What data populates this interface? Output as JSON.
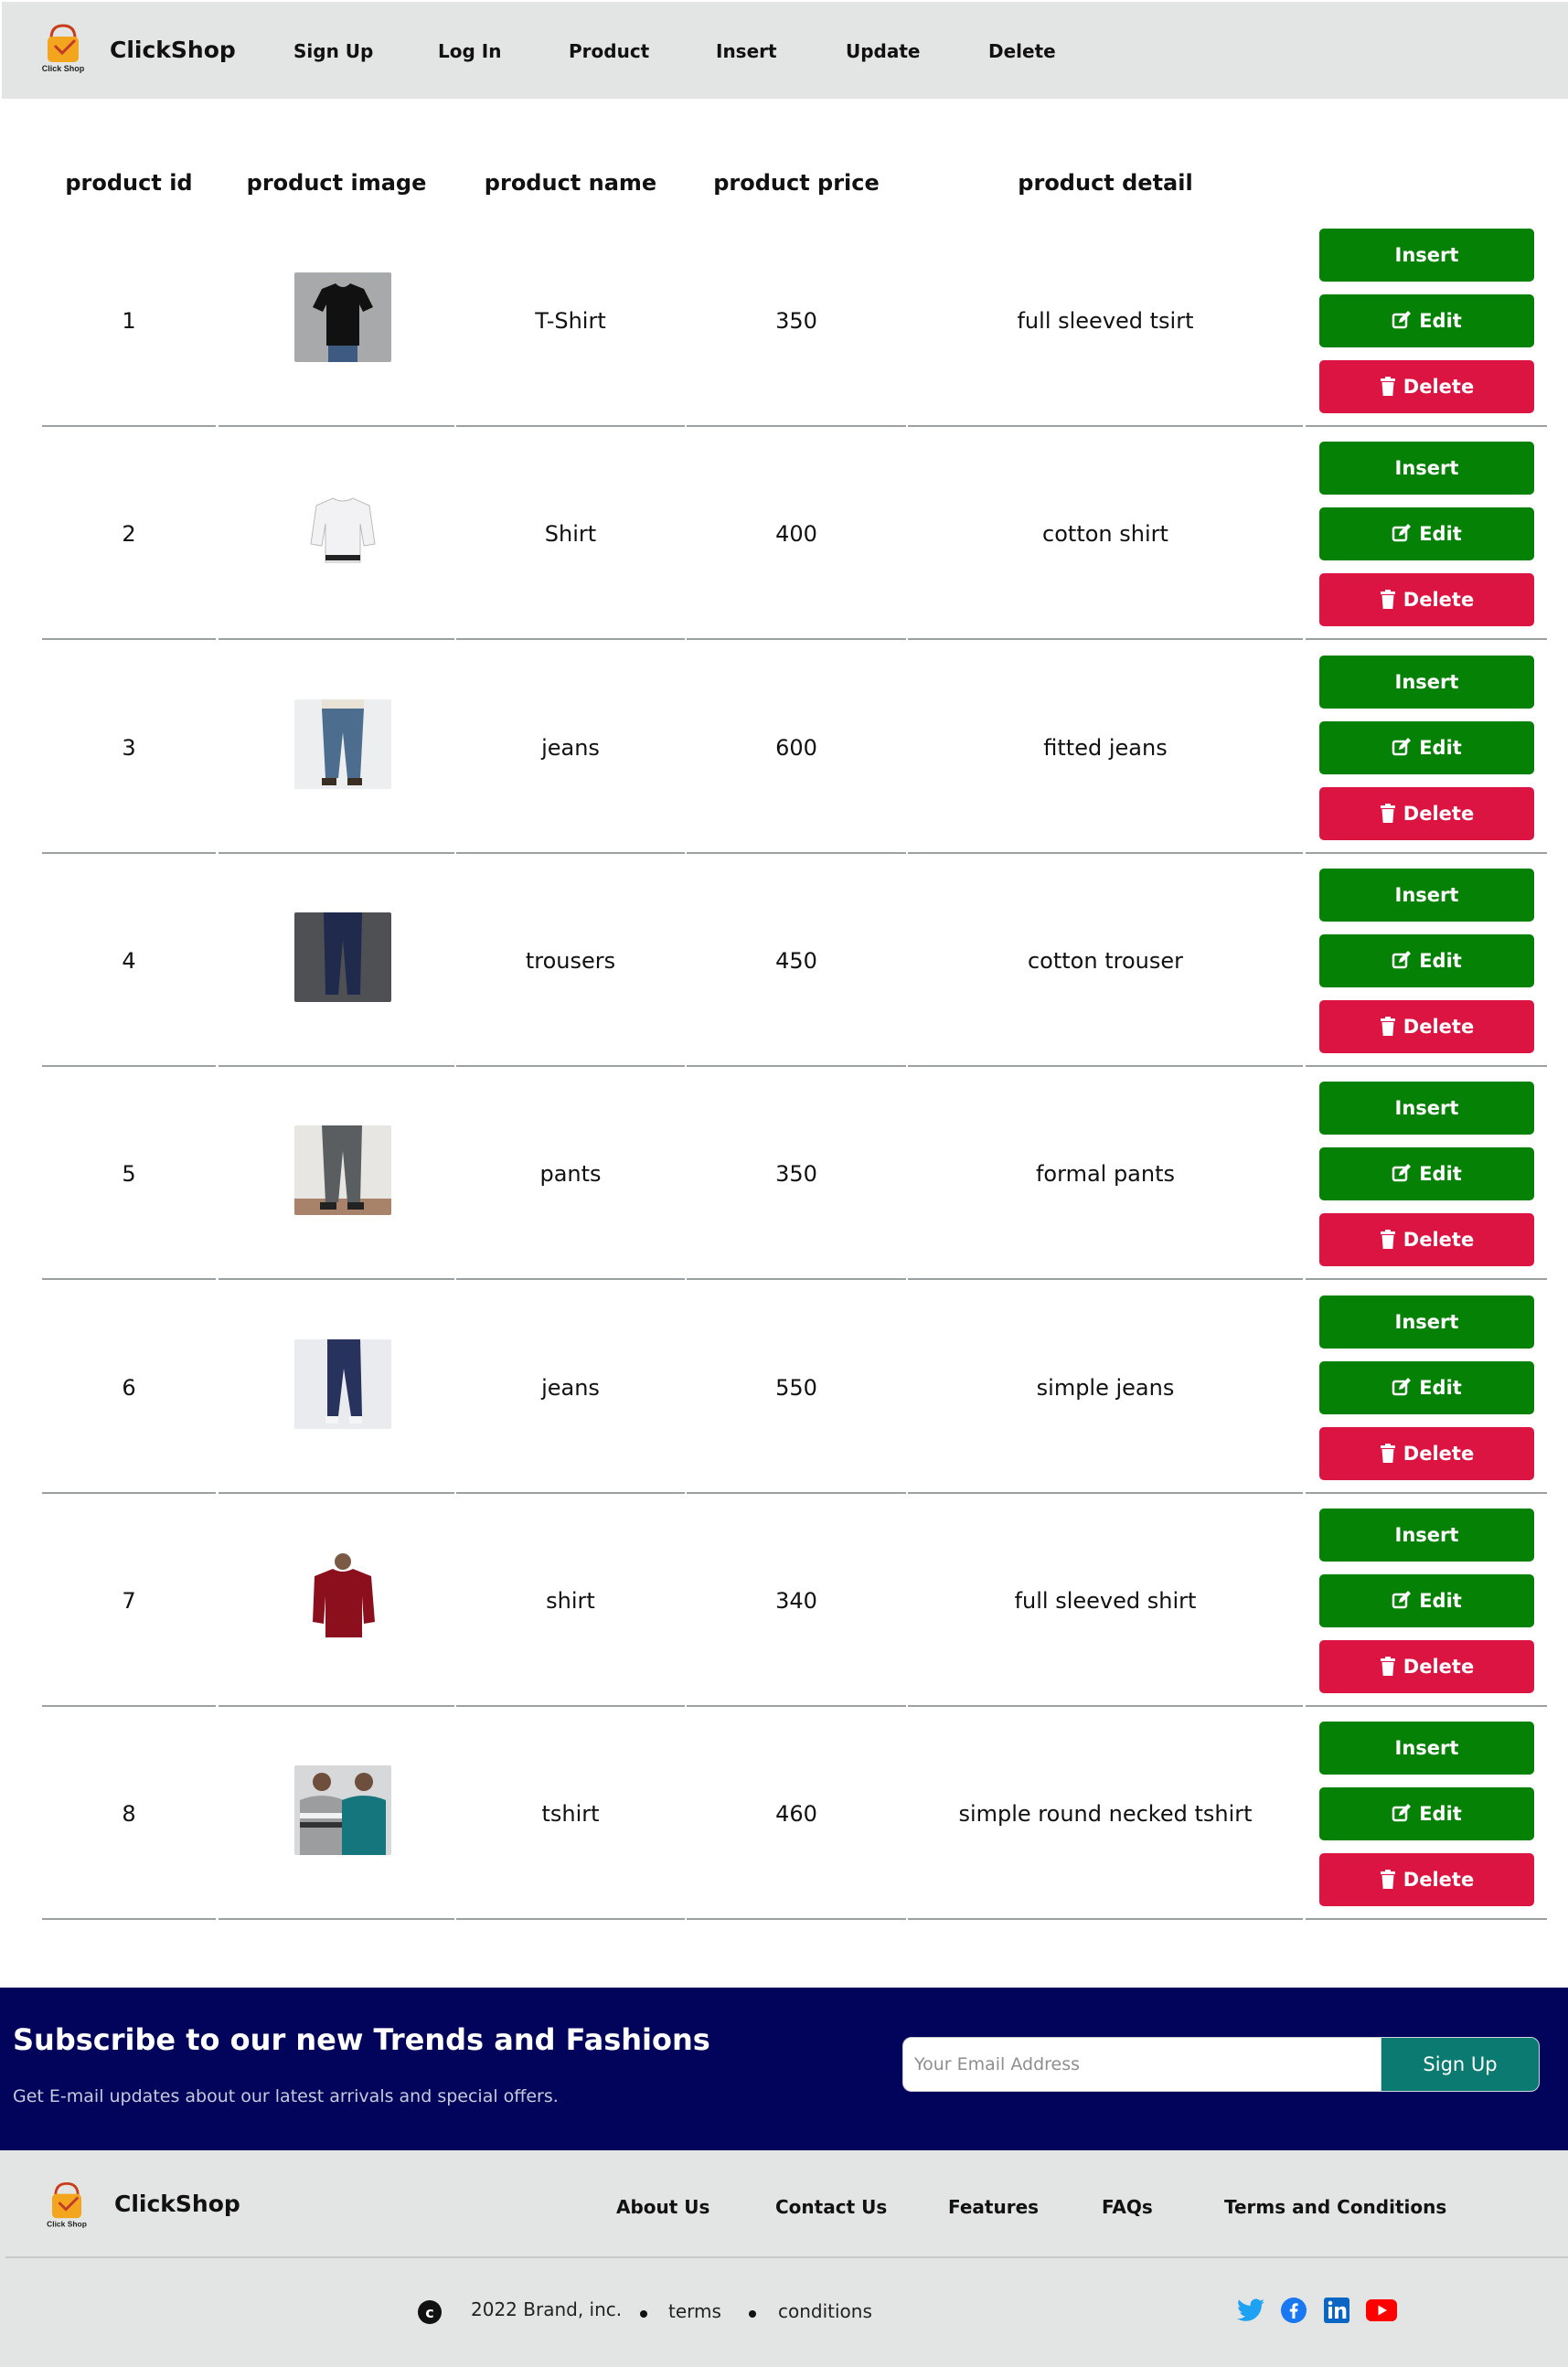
{
  "header": {
    "brand": "ClickShop",
    "logo_caption": "Click Shop",
    "nav": [
      "Sign Up",
      "Log In",
      "Product",
      "Insert",
      "Update",
      "Delete"
    ]
  },
  "table": {
    "columns": [
      "product id",
      "product image",
      "product name",
      "product price",
      "product detail"
    ],
    "rows": [
      {
        "id": "1",
        "image": "black-tshirt",
        "name": "T-Shirt",
        "price": "350",
        "detail": "full sleeved tsirt"
      },
      {
        "id": "2",
        "image": "white-shirt",
        "name": "Shirt",
        "price": "400",
        "detail": "cotton shirt"
      },
      {
        "id": "3",
        "image": "blue-jeans",
        "name": "jeans",
        "price": "600",
        "detail": "fitted jeans"
      },
      {
        "id": "4",
        "image": "navy-trousers",
        "name": "trousers",
        "price": "450",
        "detail": "cotton trouser"
      },
      {
        "id": "5",
        "image": "grey-pants",
        "name": "pants",
        "price": "350",
        "detail": "formal pants"
      },
      {
        "id": "6",
        "image": "dark-jeans",
        "name": "jeans",
        "price": "550",
        "detail": "simple jeans"
      },
      {
        "id": "7",
        "image": "red-shirt",
        "name": "shirt",
        "price": "340",
        "detail": "full sleeved shirt"
      },
      {
        "id": "8",
        "image": "round-neck-tshirts",
        "name": "tshirt",
        "price": "460",
        "detail": "simple round necked tshirt"
      }
    ],
    "actions": {
      "insert": "Insert",
      "edit": "Edit",
      "delete": "Delete"
    }
  },
  "subscribe": {
    "title": "Subscribe to our new Trends and Fashions",
    "text": "Get E-mail updates about our latest arrivals and special offers.",
    "placeholder": "Your Email Address",
    "button": "Sign Up"
  },
  "footer": {
    "brand": "ClickShop",
    "links": [
      "About Us",
      "Contact Us",
      "Features",
      "FAQs",
      "Terms and Conditions"
    ],
    "copyright": "2022 Brand, inc.",
    "small_links": [
      "terms",
      "conditions"
    ],
    "social": [
      "twitter-icon",
      "facebook-icon",
      "linkedin-icon",
      "youtube-icon"
    ]
  },
  "colors": {
    "header_bg": "#e2e5e4",
    "green": "#058105",
    "red": "#dc1442",
    "navy": "#01045a",
    "teal": "#0b7b72"
  }
}
